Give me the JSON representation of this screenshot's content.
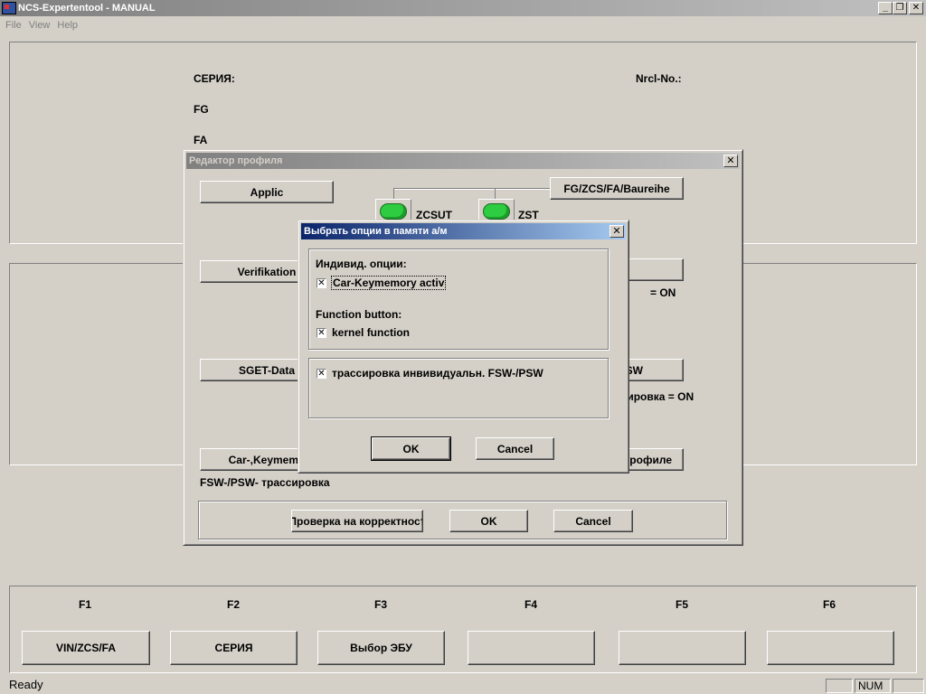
{
  "window": {
    "title": "NCS-Expertentool - MANUAL",
    "controls": {
      "minimize": "_",
      "restore": "❐",
      "close": "✕"
    }
  },
  "menu": [
    "File",
    "View",
    "Help"
  ],
  "info": {
    "series_label": "СЕРИЯ:",
    "nrcl_label": "Nrcl-No.:",
    "fg_label": "FG",
    "fa_label": "FA"
  },
  "profile_dialog": {
    "title": "Редактор профиля",
    "buttons": {
      "applic": "Applic",
      "verifikation": "Verifikation",
      "sget_data": "SGET-Data",
      "car_keymemory": "Car-,Keymemo",
      "fg_zcs": "FG/ZCS/FA/Baureihe",
      "right2": "",
      "right3": "SW",
      "right4": "профиле"
    },
    "leds": {
      "zcsut": "ZCSUT",
      "zst": "ZST"
    },
    "texts": {
      "on1": "= ON",
      "on2": "ссировка = ON",
      "fsw_trace": "FSW-/PSW- трассировка"
    },
    "footer": {
      "check": "Проверка на корректност",
      "ok": "OK",
      "cancel": "Cancel"
    }
  },
  "options_dialog": {
    "title": "Выбрать опции в памяти а/м",
    "individual_label": "Индивид. опции:",
    "car_keymemory": {
      "label": "Car-Keymemory activ",
      "checked": true
    },
    "function_label": "Function button:",
    "kernel_function": {
      "label": "kernel function",
      "checked": true
    },
    "trace": {
      "label": "трассировка инвивидуальн. FSW-/PSW",
      "checked": true
    },
    "ok": "OK",
    "cancel": "Cancel"
  },
  "fkeys": [
    {
      "key": "F1",
      "label": "VIN/ZCS/FA"
    },
    {
      "key": "F2",
      "label": "СЕРИЯ"
    },
    {
      "key": "F3",
      "label": "Выбор ЭБУ"
    },
    {
      "key": "F4",
      "label": ""
    },
    {
      "key": "F5",
      "label": ""
    },
    {
      "key": "F6",
      "label": ""
    }
  ],
  "status": {
    "text": "Ready",
    "num": "NUM"
  }
}
